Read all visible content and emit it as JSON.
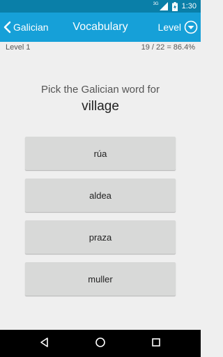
{
  "status_bar": {
    "network_label": "3G",
    "time": "1:30"
  },
  "app_bar": {
    "back_label": "Galician",
    "title": "Vocabulary",
    "level_menu_label": "Level"
  },
  "info": {
    "level": "Level 1",
    "score": "19 / 22 = 86.4%"
  },
  "question": {
    "prompt": "Pick the Galician word for",
    "word": "village"
  },
  "answers": [
    {
      "label": "rúa"
    },
    {
      "label": "aldea"
    },
    {
      "label": "praza"
    },
    {
      "label": "muller"
    }
  ],
  "colors": {
    "status_bar": "#0a7fa8",
    "app_bar": "#16a0d8",
    "background": "#efefef",
    "answer_button": "#d8d9d8",
    "nav_bar": "#000000"
  },
  "icons": {
    "back": "chevron-left-icon",
    "level_menu": "circle-chevron-down-icon",
    "signal": "signal-icon",
    "battery": "battery-charging-icon",
    "nav_back": "triangle-back-icon",
    "nav_home": "circle-home-icon",
    "nav_recents": "square-recents-icon"
  }
}
